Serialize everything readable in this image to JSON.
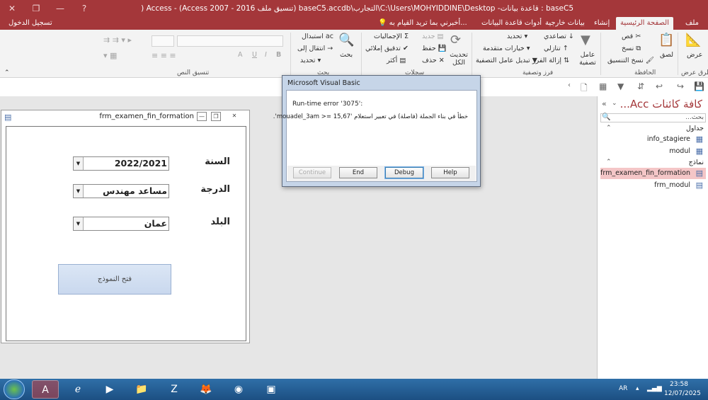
{
  "app": {
    "title": "baseC5 : قاعدة بيانات- C:\\Users\\MOHYIDDINE\\Desktop\\التجارب\\baseC5.accdb (تنسيق ملف Access 2007 - 2016) - Access (فشل تنشيط المنتج)",
    "window_controls": [
      "✕",
      "❐",
      "—",
      "?"
    ]
  },
  "tabs": {
    "items": [
      "ملف",
      "الصفحة الرئيسية",
      "إنشاء",
      "بيانات خارجية",
      "أدوات قاعدة البيانات"
    ],
    "tell_me": "أخبرني بما تريد القيام به...",
    "sign_in": "تسجيل الدخول"
  },
  "ribbon": {
    "views": {
      "view": "عرض",
      "group": "طرق عرض"
    },
    "clipboard": {
      "paste": "لصق",
      "cut": "قص",
      "copy": "نسخ",
      "format_painter": "نسخ التنسيق",
      "group": "الحافظة"
    },
    "sort_filter": {
      "filter": "عامل تصفية",
      "ascending": "تصاعدي",
      "descending": "تنازلي",
      "remove_sort": "إزالة الفرز",
      "selection": "تحديد",
      "advanced": "خيارات متقدمة",
      "toggle_filter": "تبديل عامل التصفية",
      "group": "فرز وتصفية"
    },
    "records": {
      "refresh_all": "تحديث الكل",
      "new": "جديد",
      "save": "حفظ",
      "delete": "حذف",
      "totals": "الإجماليات",
      "spelling": "تدقيق إملائي",
      "more": "أكثر",
      "group": "سجلات"
    },
    "find": {
      "find": "بحث",
      "replace": "استبدال",
      "goto": "انتقال إلى",
      "select": "تحديد",
      "group": "بحث"
    },
    "text_formatting": {
      "bold": "B",
      "italic": "I",
      "underline": "U",
      "font_color": "A",
      "group": "تنسيق النص"
    }
  },
  "form": {
    "title": "frm_examen_fin_formation",
    "fields": [
      {
        "label": "السنة",
        "value": "2022/2021"
      },
      {
        "label": "الدرجة",
        "value": "مساعد مهندس"
      },
      {
        "label": "البلد",
        "value": "عمان"
      }
    ],
    "open_button": "فتح النموذج"
  },
  "dialog": {
    "title": "Microsoft Visual Basic",
    "error": "Run-time error '3075':",
    "message": "خطأ في بناء الجملة (فاصلة) في تعبير استعلام 'mouadel_3am >= 15,67'.",
    "buttons": {
      "continue": "Continue",
      "end": "End",
      "debug": "Debug",
      "help": "Help"
    }
  },
  "nav": {
    "title": "كافة كائنات Acc...",
    "search_placeholder": "بحث...",
    "groups": [
      {
        "name": "جداول",
        "items": [
          "info_stagiere",
          "modul"
        ]
      },
      {
        "name": "نماذج",
        "items": [
          "frm_examen_fin_formation",
          "frm_modul"
        ]
      }
    ]
  },
  "taskbar": {
    "apps": [
      "access",
      "internet-explorer",
      "media-player",
      "file-explorer",
      "filezilla",
      "firefox",
      "chrome",
      "virtualbox"
    ],
    "language": "AR",
    "time": "23:58",
    "date": "12/07/2025"
  },
  "colors": {
    "accent": "#a4373a",
    "taskbar": "#1c4f82",
    "selected_nav": "#f4c6c7"
  }
}
